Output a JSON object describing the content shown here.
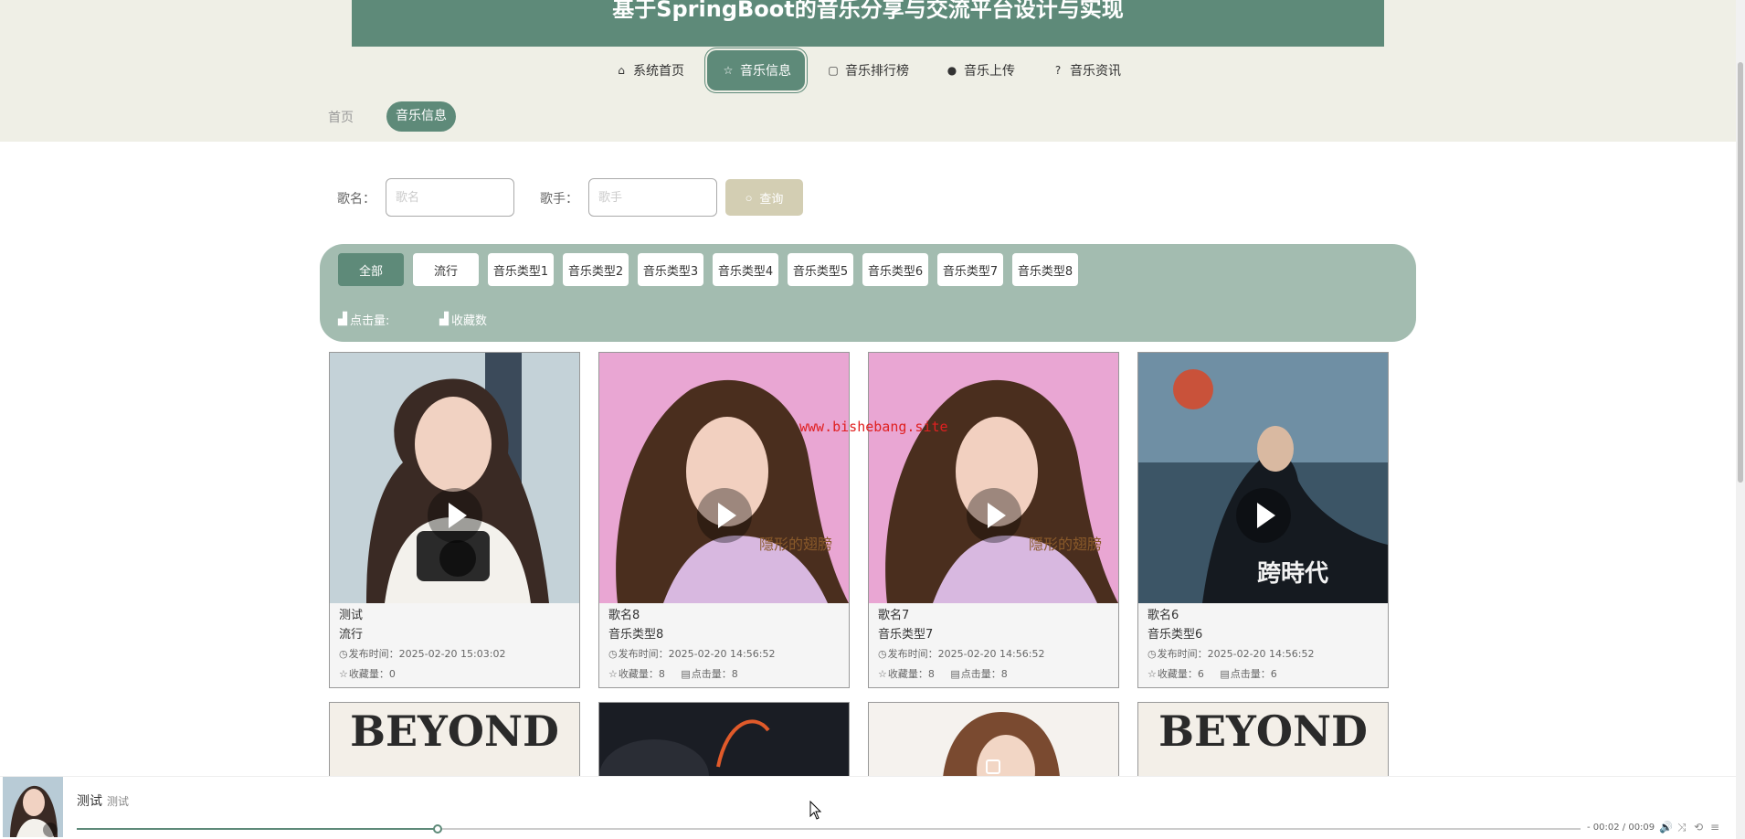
{
  "header": {
    "title": "基于SpringBoot的音乐分享与交流平台设计与实现"
  },
  "nav": {
    "items": [
      {
        "label": "系统首页",
        "icon": "home-icon"
      },
      {
        "label": "音乐信息",
        "icon": "star-icon",
        "active": true
      },
      {
        "label": "音乐排行榜",
        "icon": "bag-icon"
      },
      {
        "label": "音乐上传",
        "icon": "info-icon"
      },
      {
        "label": "音乐资讯",
        "icon": "question-icon"
      }
    ]
  },
  "breadcrumb": {
    "home": "首页",
    "current": "音乐信息"
  },
  "search": {
    "song_label": "歌名：",
    "song_placeholder": "歌名",
    "song_value": "",
    "singer_label": "歌手：",
    "singer_placeholder": "歌手",
    "singer_value": "",
    "button_label": "查询"
  },
  "filters": {
    "categories": [
      "全部",
      "流行",
      "音乐类型1",
      "音乐类型2",
      "音乐类型3",
      "音乐类型4",
      "音乐类型5",
      "音乐类型6",
      "音乐类型7",
      "音乐类型8"
    ],
    "active": "全部",
    "sort_clicks": "点击量:",
    "sort_favorites": "收藏数"
  },
  "cards": [
    {
      "name": "测试",
      "type": "流行",
      "time_label": "发布时间：",
      "time": "2025-02-20 15:03:02",
      "fav_label": "收藏量：",
      "fav": "0"
    },
    {
      "name": "歌名8",
      "type": "音乐类型8",
      "time_label": "发布时间：",
      "time": "2025-02-20 14:56:52",
      "fav_label": "收藏量：",
      "fav": "8",
      "click_label": "点击量：",
      "click": "8"
    },
    {
      "name": "歌名7",
      "type": "音乐类型7",
      "time_label": "发布时间：",
      "time": "2025-02-20 14:56:52",
      "fav_label": "收藏量：",
      "fav": "8",
      "click_label": "点击量：",
      "click": "8"
    },
    {
      "name": "歌名6",
      "type": "音乐类型6",
      "time_label": "发布时间：",
      "time": "2025-02-20 14:56:52",
      "fav_label": "收藏量：",
      "fav": "6",
      "click_label": "点击量：",
      "click": "6"
    }
  ],
  "second_row": {
    "covers": [
      "BEYOND",
      "",
      "",
      "BEYOND"
    ]
  },
  "watermark": "www.bishebang.site",
  "player": {
    "title": "测试",
    "artist": "测试",
    "time": "- 00:02 / 00:09",
    "progress": 0.24
  },
  "colors": {
    "primary": "#5e8a79",
    "filter_bg": "#a3bcb0",
    "top_bg": "#efefe6",
    "search_btn": "#d3ceb3"
  }
}
